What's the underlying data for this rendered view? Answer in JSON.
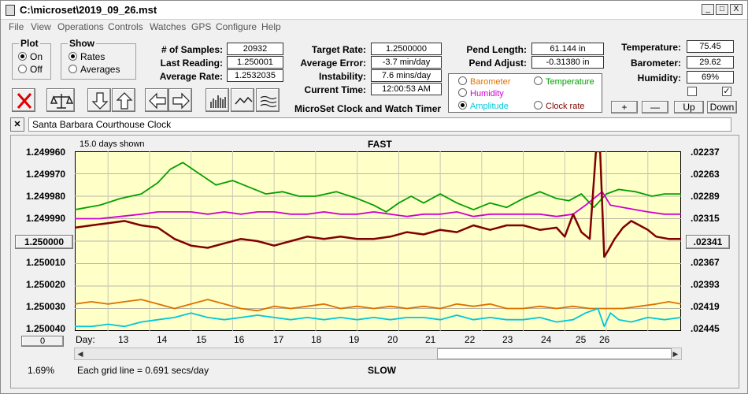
{
  "window": {
    "title": "C:\\microset\\2019_09_26.mst",
    "minimize": "_",
    "maximize": "□",
    "close": "X"
  },
  "menu": [
    "File",
    "View",
    "Operations",
    "Controls",
    "Watches",
    "GPS",
    "Configure",
    "Help"
  ],
  "plot_group": {
    "title": "Plot",
    "options": [
      "On",
      "Off"
    ],
    "selected": "On"
  },
  "show_group": {
    "title": "Show",
    "options": [
      "Rates",
      "Averages"
    ],
    "selected": "Rates"
  },
  "stats": [
    {
      "label": "# of Samples:",
      "value": "20932"
    },
    {
      "label": "Last Reading:",
      "value": "1.250001"
    },
    {
      "label": "Average Rate:",
      "value": "1.2532035"
    },
    {
      "label": "Target Rate:",
      "value": "1.2500000"
    },
    {
      "label": "Average Error:",
      "value": "-3.7 min/day"
    },
    {
      "label": "Instability:",
      "value": "7.6 mins/day"
    },
    {
      "label": "Current Time:",
      "value": "12:00:53 AM"
    },
    {
      "label": "Pend Length:",
      "value": "61.144 in"
    },
    {
      "label": "Pend Adjust:",
      "value": "-0.31380 in"
    },
    {
      "label": "Temperature:",
      "value": "75.45"
    },
    {
      "label": "Barometer:",
      "value": "29.62"
    },
    {
      "label": "Humidity:",
      "value": "69%"
    }
  ],
  "app_heading": "MicroSet Clock and Watch Timer",
  "sources": [
    {
      "label": "Barometer",
      "color": "#e07000",
      "selected": false
    },
    {
      "label": "Temperature",
      "color": "#00a000",
      "selected": false
    },
    {
      "label": "Humidity",
      "color": "#d000d0",
      "selected": false
    },
    {
      "label": "Amplitude",
      "color": "#00c8d8",
      "selected": true
    },
    {
      "label": "Clock rate",
      "color": "#800000",
      "selected": false
    }
  ],
  "controls": {
    "plus": "+",
    "minus": "—",
    "up": "Up",
    "down": "Down",
    "check_left": "",
    "check_right": "✓"
  },
  "clock_name": "Santa Barbara Courthouse Clock",
  "plot": {
    "days_shown": "15.0 days shown",
    "fast_label": "FAST",
    "slow_label": "SLOW",
    "left_ticks": [
      "1.249960",
      "1.249970",
      "1.249980",
      "1.249990",
      "1.250000",
      "1.250010",
      "1.250020",
      "1.250030",
      "1.250040"
    ],
    "right_ticks": [
      ".02237",
      ".02263",
      ".02289",
      ".02315",
      ".02341",
      ".02367",
      ".02393",
      ".02419",
      ".02445"
    ],
    "left_center_button": "1.250000",
    "right_center_button": ".02341",
    "zero_button": "0",
    "day_label": "Day:",
    "days": [
      "13",
      "14",
      "15",
      "16",
      "17",
      "18",
      "19",
      "20",
      "21",
      "22",
      "23",
      "24",
      "25",
      "26"
    ],
    "percent": "1.69%",
    "grid_note": "Each grid line = 0.691 secs/day",
    "background": "#ffffc8"
  },
  "chart_data": {
    "type": "line",
    "x_label": "Day:",
    "x_ticks": [
      13,
      14,
      15,
      16,
      17,
      18,
      19,
      20,
      21,
      22,
      23,
      24,
      25,
      26
    ],
    "x_range": [
      12.2,
      26.8
    ],
    "y_range": [
      1.24996,
      1.25004
    ],
    "y_ticks": [
      1.24996,
      1.24997,
      1.24998,
      1.24999,
      1.25,
      1.25001,
      1.25002,
      1.25003,
      1.25004
    ],
    "y2_ticks": [
      0.02237,
      0.02263,
      0.02289,
      0.02315,
      0.02341,
      0.02367,
      0.02393,
      0.02419,
      0.02445
    ],
    "grid": true,
    "series": [
      {
        "name": "Temperature",
        "color": "#00a000",
        "x": [
          12.2,
          12.8,
          13.3,
          13.8,
          14.2,
          14.5,
          14.8,
          15.2,
          15.6,
          16.0,
          16.4,
          16.8,
          17.2,
          17.6,
          18.0,
          18.5,
          19.0,
          19.4,
          19.7,
          20.0,
          20.3,
          20.6,
          21.0,
          21.4,
          21.8,
          22.2,
          22.6,
          23.0,
          23.4,
          23.8,
          24.1,
          24.4,
          24.7,
          25.0,
          25.3,
          25.7,
          26.1,
          26.4,
          26.8
        ],
        "y": [
          1.249986,
          1.249984,
          1.249981,
          1.249979,
          1.249974,
          1.249968,
          1.249965,
          1.24997,
          1.249975,
          1.249973,
          1.249976,
          1.249979,
          1.249978,
          1.24998,
          1.24998,
          1.249978,
          1.249981,
          1.249984,
          1.249987,
          1.249983,
          1.24998,
          1.249983,
          1.249979,
          1.249983,
          1.249986,
          1.249983,
          1.249985,
          1.249981,
          1.249978,
          1.249981,
          1.249982,
          1.249979,
          1.249985,
          1.249979,
          1.249977,
          1.249978,
          1.24998,
          1.249979,
          1.249979
        ]
      },
      {
        "name": "Humidity",
        "color": "#d000d0",
        "x": [
          12.2,
          12.8,
          13.3,
          13.8,
          14.2,
          14.6,
          15.0,
          15.4,
          15.8,
          16.2,
          16.6,
          17.0,
          17.4,
          17.8,
          18.2,
          18.6,
          19.0,
          19.4,
          19.8,
          20.2,
          20.6,
          21.0,
          21.4,
          21.8,
          22.2,
          22.6,
          23.0,
          23.4,
          23.8,
          24.2,
          24.5,
          24.7,
          24.9,
          25.1,
          25.4,
          25.7,
          26.0,
          26.4,
          26.8
        ],
        "y": [
          1.24999,
          1.24999,
          1.249989,
          1.249988,
          1.249987,
          1.249987,
          1.249987,
          1.249988,
          1.249987,
          1.249988,
          1.249987,
          1.249987,
          1.249988,
          1.249988,
          1.249987,
          1.249988,
          1.249988,
          1.249987,
          1.249988,
          1.249989,
          1.249988,
          1.249988,
          1.249987,
          1.249989,
          1.249988,
          1.249988,
          1.249988,
          1.249988,
          1.249989,
          1.249988,
          1.249984,
          1.249981,
          1.249978,
          1.249984,
          1.249985,
          1.249986,
          1.249987,
          1.249988,
          1.249988
        ]
      },
      {
        "name": "Clock rate",
        "color": "#800000",
        "x": [
          12.2,
          12.6,
          13.0,
          13.4,
          13.8,
          14.2,
          14.6,
          15.0,
          15.4,
          15.8,
          16.2,
          16.6,
          17.0,
          17.4,
          17.8,
          18.2,
          18.6,
          19.0,
          19.4,
          19.8,
          20.2,
          20.6,
          21.0,
          21.4,
          21.8,
          22.2,
          22.6,
          23.0,
          23.4,
          23.8,
          24.0,
          24.2,
          24.4,
          24.6,
          24.75,
          24.85,
          24.95,
          25.05,
          25.2,
          25.4,
          25.6,
          25.8,
          26.0,
          26.2,
          26.5,
          26.8
        ],
        "y": [
          1.249994,
          1.249993,
          1.249992,
          1.249991,
          1.249993,
          1.249994,
          1.249999,
          1.250002,
          1.250003,
          1.250001,
          1.249999,
          1.25,
          1.250002,
          1.25,
          1.249998,
          1.249999,
          1.249998,
          1.249999,
          1.249999,
          1.249998,
          1.249996,
          1.249997,
          1.249995,
          1.249996,
          1.249993,
          1.249995,
          1.249993,
          1.249993,
          1.249995,
          1.249994,
          1.249998,
          1.249988,
          1.249996,
          1.249999,
          1.24996,
          1.24996,
          1.250007,
          1.250004,
          1.249999,
          1.249994,
          1.249991,
          1.249993,
          1.249995,
          1.249998,
          1.249999,
          1.249999
        ]
      },
      {
        "name": "Barometer",
        "color": "#e07000",
        "x": [
          12.2,
          12.6,
          13.0,
          13.4,
          13.8,
          14.2,
          14.6,
          15.0,
          15.4,
          15.8,
          16.2,
          16.6,
          17.0,
          17.4,
          17.8,
          18.2,
          18.6,
          19.0,
          19.4,
          19.8,
          20.2,
          20.6,
          21.0,
          21.4,
          21.8,
          22.2,
          22.6,
          23.0,
          23.4,
          23.8,
          24.2,
          24.6,
          25.0,
          25.4,
          25.8,
          26.2,
          26.5,
          26.8
        ],
        "y": [
          1.250028,
          1.250027,
          1.250028,
          1.250027,
          1.250026,
          1.250028,
          1.25003,
          1.250028,
          1.250026,
          1.250028,
          1.25003,
          1.250031,
          1.250029,
          1.25003,
          1.250029,
          1.250028,
          1.25003,
          1.250029,
          1.25003,
          1.250029,
          1.25003,
          1.250029,
          1.25003,
          1.250028,
          1.250029,
          1.250028,
          1.25003,
          1.25003,
          1.250029,
          1.25003,
          1.250029,
          1.25003,
          1.25003,
          1.25003,
          1.250029,
          1.250028,
          1.250027,
          1.250028
        ]
      },
      {
        "name": "Amplitude",
        "color": "#00c8d8",
        "x": [
          12.2,
          12.6,
          13.0,
          13.4,
          13.8,
          14.2,
          14.6,
          15.0,
          15.4,
          15.8,
          16.2,
          16.6,
          17.0,
          17.4,
          17.8,
          18.2,
          18.6,
          19.0,
          19.4,
          19.8,
          20.2,
          20.6,
          21.0,
          21.4,
          21.8,
          22.2,
          22.6,
          23.0,
          23.4,
          23.8,
          24.2,
          24.5,
          24.8,
          24.95,
          25.1,
          25.3,
          25.6,
          26.0,
          26.4,
          26.8
        ],
        "y": [
          1.250038,
          1.250038,
          1.250037,
          1.250038,
          1.250036,
          1.250035,
          1.250034,
          1.250032,
          1.250034,
          1.250035,
          1.250034,
          1.250033,
          1.250034,
          1.250035,
          1.250034,
          1.250035,
          1.250034,
          1.250035,
          1.250034,
          1.250035,
          1.250034,
          1.250034,
          1.250035,
          1.250033,
          1.250035,
          1.250034,
          1.250035,
          1.250035,
          1.250034,
          1.250036,
          1.250035,
          1.250032,
          1.25003,
          1.250038,
          1.250032,
          1.250035,
          1.250036,
          1.250034,
          1.250035,
          1.250034
        ]
      }
    ]
  }
}
